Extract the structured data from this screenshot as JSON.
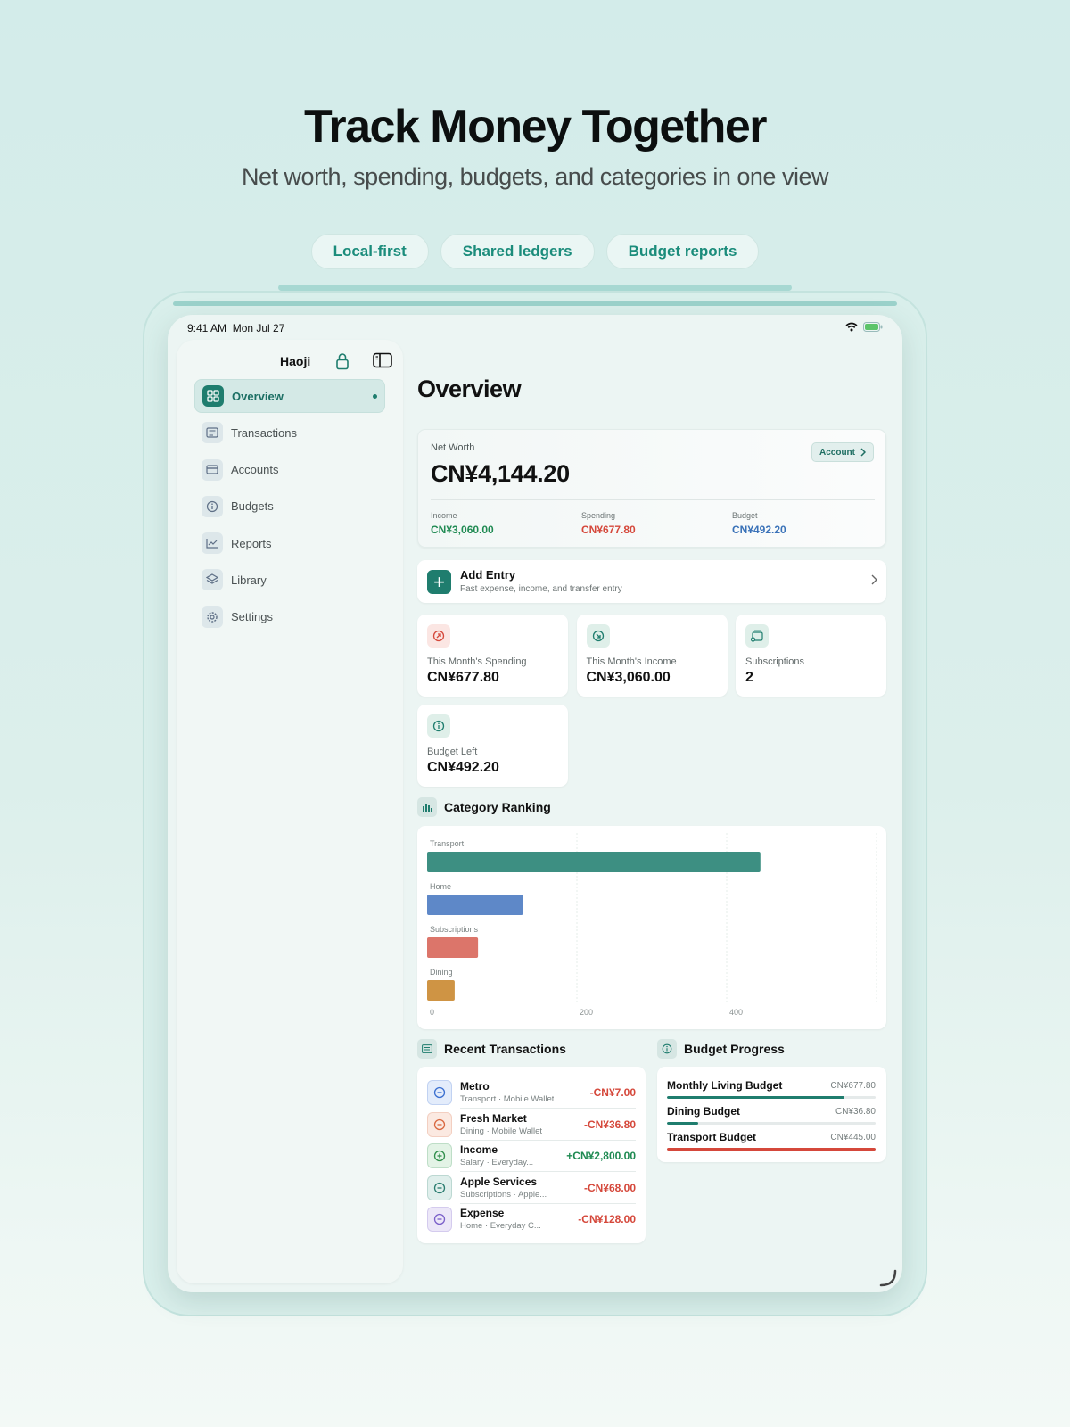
{
  "headline": "Track Money Together",
  "subhead": "Net worth, spending, budgets, and categories in one view",
  "pills": [
    "Local-first",
    "Shared ledgers",
    "Budget reports"
  ],
  "status": {
    "time": "9:41 AM",
    "date": "Mon Jul 27"
  },
  "sidebar": {
    "user": "Haoji",
    "items": [
      {
        "label": "Overview",
        "icon": "grid-icon",
        "active": true
      },
      {
        "label": "Transactions",
        "icon": "list-icon",
        "active": false
      },
      {
        "label": "Accounts",
        "icon": "card-icon",
        "active": false
      },
      {
        "label": "Budgets",
        "icon": "info-circle-icon",
        "active": false
      },
      {
        "label": "Reports",
        "icon": "line-chart-icon",
        "active": false
      },
      {
        "label": "Library",
        "icon": "layers-icon",
        "active": false
      },
      {
        "label": "Settings",
        "icon": "gear-icon",
        "active": false
      }
    ]
  },
  "overview": {
    "title": "Overview",
    "net_worth": {
      "label": "Net Worth",
      "value": "CN¥4,144.20",
      "account_button": "Account",
      "income_label": "Income",
      "income": "CN¥3,060.00",
      "spending_label": "Spending",
      "spending": "CN¥677.80",
      "budget_label": "Budget",
      "budget": "CN¥492.20"
    },
    "add_entry": {
      "title": "Add Entry",
      "subtitle": "Fast expense, income, and transfer entry"
    },
    "stats": [
      {
        "label": "This Month's Spending",
        "value": "CN¥677.80",
        "icon": "arrow-up-circle-icon"
      },
      {
        "label": "This Month's Income",
        "value": "CN¥3,060.00",
        "icon": "arrow-down-circle-icon"
      },
      {
        "label": "Subscriptions",
        "value": "2",
        "icon": "subscription-icon"
      },
      {
        "label": "Budget Left",
        "value": "CN¥492.20",
        "icon": "info-circle-icon"
      }
    ],
    "category_ranking_title": "Category Ranking",
    "recent_title": "Recent Transactions",
    "budget_progress_title": "Budget Progress"
  },
  "colors": {
    "accent": "#1f7d6e",
    "income": "#1f8a52",
    "spending": "#d5483b",
    "budget": "#3a72b8"
  },
  "chart_data": {
    "type": "bar",
    "orientation": "horizontal",
    "categories": [
      "Transport",
      "Home",
      "Subscriptions",
      "Dining"
    ],
    "values": [
      445,
      128,
      68,
      36.8
    ],
    "colors": [
      "#3d8f82",
      "#5e88c8",
      "#dc756a",
      "#cf9444"
    ],
    "xlim": [
      0,
      600
    ],
    "xticks": [
      0,
      200,
      400
    ],
    "grid": true
  },
  "transactions": [
    {
      "name": "Metro",
      "sub": "Transport · Mobile Wallet",
      "amount": "-CN¥7.00",
      "type": "expense",
      "tint": "#e3ecfb",
      "fg": "#3a6fd0",
      "icon": "minus-circle-icon"
    },
    {
      "name": "Fresh Market",
      "sub": "Dining · Mobile Wallet",
      "amount": "-CN¥36.80",
      "type": "expense",
      "tint": "#fbe9e1",
      "fg": "#d9673f",
      "icon": "minus-circle-icon"
    },
    {
      "name": "Income",
      "sub": "Salary · Everyday...",
      "amount": "+CN¥2,800.00",
      "type": "income",
      "tint": "#e3f3e6",
      "fg": "#2f8e4b",
      "icon": "plus-circle-icon"
    },
    {
      "name": "Apple Services",
      "sub": "Subscriptions · Apple...",
      "amount": "-CN¥68.00",
      "type": "expense",
      "tint": "#e0efec",
      "fg": "#2b7d70",
      "icon": "minus-circle-icon"
    },
    {
      "name": "Expense",
      "sub": "Home · Everyday C...",
      "amount": "-CN¥128.00",
      "type": "expense",
      "tint": "#ece7f8",
      "fg": "#7a5fc9",
      "icon": "minus-circle-icon"
    }
  ],
  "budgets": [
    {
      "name": "Monthly Living Budget",
      "amount": "CN¥677.80",
      "progress": 0.85,
      "color": "#1f7d6e"
    },
    {
      "name": "Dining Budget",
      "amount": "CN¥36.80",
      "progress": 0.15,
      "color": "#1f7d6e"
    },
    {
      "name": "Transport Budget",
      "amount": "CN¥445.00",
      "progress": 1.0,
      "color": "#d5483b"
    }
  ]
}
